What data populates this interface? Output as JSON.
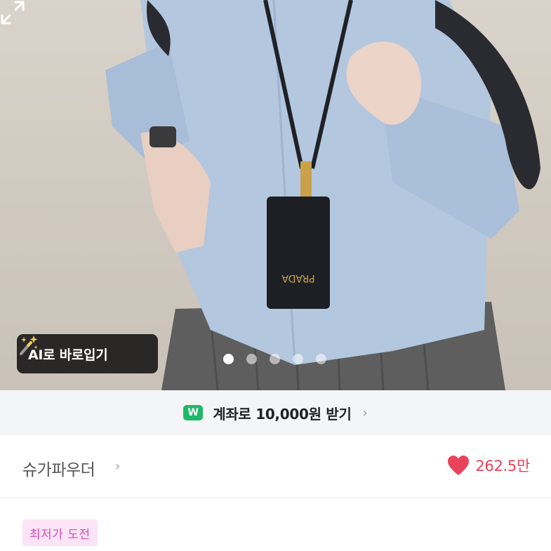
{
  "photo": {
    "alt_icons": [
      "sparkle-wand-icon",
      "expand-icon"
    ],
    "carousel_dots": 5,
    "active_dot": 0,
    "ai_button_label": "AI로 바로입기",
    "card_brand_text": "PRADA"
  },
  "banner": {
    "badge_text": "W",
    "text": "계좌로 10,000원 받기",
    "chevron": "›"
  },
  "seller": {
    "name": "슈가파우더",
    "chevron": "›",
    "likes": "262.5만"
  },
  "chip": {
    "label": "최저가 도전"
  },
  "colors": {
    "heart": "#e8435a",
    "chip_bg": "#fbe4f6",
    "chip_text": "#d24fb4",
    "badge_green": "#1fb86a"
  }
}
